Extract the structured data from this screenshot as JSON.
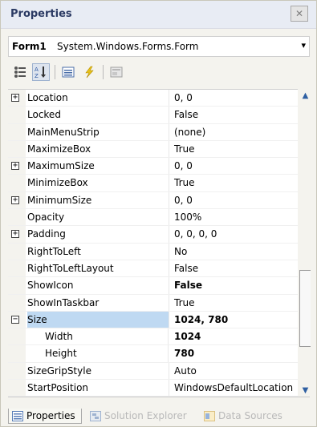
{
  "window": {
    "title": "Properties",
    "close_glyph": "✕"
  },
  "object_selector": {
    "name": "Form1",
    "type": "System.Windows.Forms.Form"
  },
  "toolbar": {
    "buttons": [
      "categorized-icon",
      "alphabetical-icon",
      "properties-icon",
      "events-icon",
      "property-pages-icon"
    ]
  },
  "properties": [
    {
      "name": "Location",
      "value": "0, 0",
      "expander": "+"
    },
    {
      "name": "Locked",
      "value": "False"
    },
    {
      "name": "MainMenuStrip",
      "value": "(none)"
    },
    {
      "name": "MaximizeBox",
      "value": "True"
    },
    {
      "name": "MaximumSize",
      "value": "0, 0",
      "expander": "+"
    },
    {
      "name": "MinimizeBox",
      "value": "True"
    },
    {
      "name": "MinimumSize",
      "value": "0, 0",
      "expander": "+"
    },
    {
      "name": "Opacity",
      "value": "100%"
    },
    {
      "name": "Padding",
      "value": "0, 0, 0, 0",
      "expander": "+"
    },
    {
      "name": "RightToLeft",
      "value": "No"
    },
    {
      "name": "RightToLeftLayout",
      "value": "False"
    },
    {
      "name": "ShowIcon",
      "value": "False",
      "bold": true
    },
    {
      "name": "ShowInTaskbar",
      "value": "True"
    },
    {
      "name": "Size",
      "value": "1024, 780",
      "expander": "−",
      "bold": true,
      "selected": true
    },
    {
      "name": "Width",
      "value": "1024",
      "bold": true,
      "child": true
    },
    {
      "name": "Height",
      "value": "780",
      "bold": true,
      "child": true
    },
    {
      "name": "SizeGripStyle",
      "value": "Auto"
    },
    {
      "name": "StartPosition",
      "value": "WindowsDefaultLocation"
    }
  ],
  "tabs": [
    {
      "label": "Properties",
      "active": true
    },
    {
      "label": "Solution Explorer",
      "active": false
    },
    {
      "label": "Data Sources",
      "active": false
    }
  ],
  "colors": {
    "selected_row": "#bfd9f2",
    "panel_bg": "#f4f3ee",
    "title_text": "#2b3a63"
  }
}
